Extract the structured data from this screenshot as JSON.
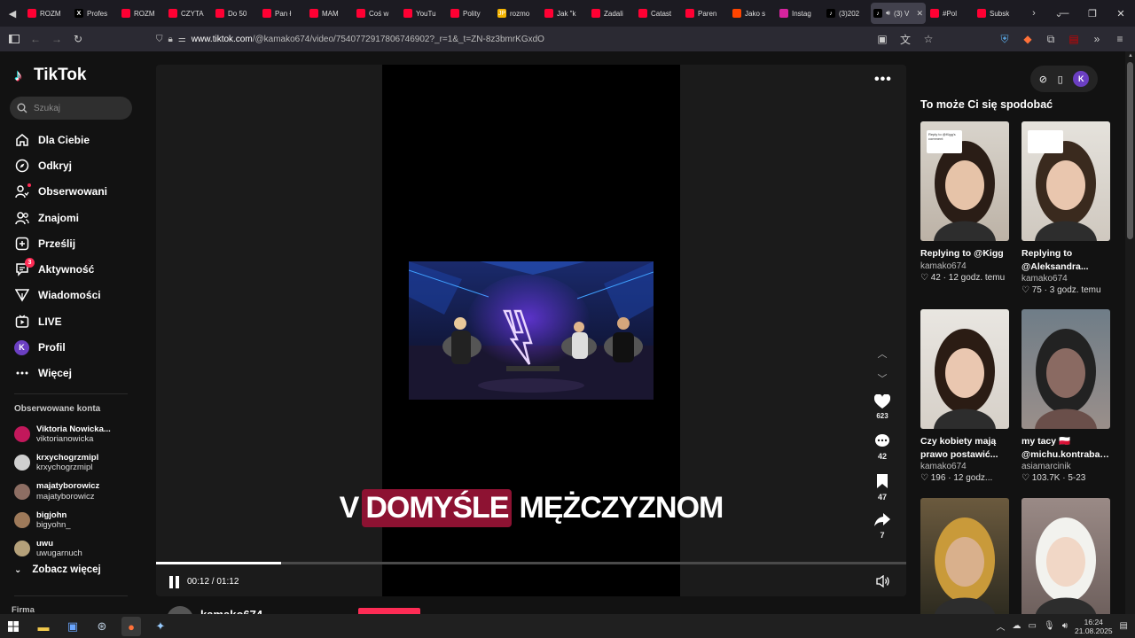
{
  "browser": {
    "tabs": [
      {
        "label": "ROZM",
        "color": "#ff0033",
        "glyph": ""
      },
      {
        "label": "Profes",
        "color": "#000000",
        "glyph": "X"
      },
      {
        "label": "ROZM",
        "color": "#ff0033",
        "glyph": ""
      },
      {
        "label": "CZYTA",
        "color": "#ff0033",
        "glyph": ""
      },
      {
        "label": "Do 50",
        "color": "#ff0033",
        "glyph": ""
      },
      {
        "label": "Pan ł",
        "color": "#ff0033",
        "glyph": ""
      },
      {
        "label": "MAM",
        "color": "#ff0033",
        "glyph": ""
      },
      {
        "label": "Coś w",
        "color": "#ff0033",
        "glyph": ""
      },
      {
        "label": "YouTu",
        "color": "#ff0033",
        "glyph": ""
      },
      {
        "label": "Polity",
        "color": "#ff0033",
        "glyph": ""
      },
      {
        "label": "rozmo",
        "color": "#f4b400",
        "glyph": "JP"
      },
      {
        "label": "Jak \"k",
        "color": "#ff0033",
        "glyph": ""
      },
      {
        "label": "Zadali",
        "color": "#ff0033",
        "glyph": ""
      },
      {
        "label": "Catast",
        "color": "#ff0033",
        "glyph": ""
      },
      {
        "label": "Paren",
        "color": "#ff0033",
        "glyph": ""
      },
      {
        "label": "Jako s",
        "color": "#ff4500",
        "glyph": ""
      },
      {
        "label": "Instag",
        "color": "#d6249f",
        "glyph": ""
      },
      {
        "label": "(3)202",
        "color": "#000000",
        "glyph": "♪"
      },
      {
        "label": "(3) V",
        "color": "#000000",
        "glyph": "♪",
        "active": true
      },
      {
        "label": "#Pol",
        "color": "#ff0033",
        "glyph": ""
      },
      {
        "label": "Subsk",
        "color": "#ff0033",
        "glyph": ""
      }
    ],
    "url_domain": "www.tiktok.com",
    "url_path": "/@kamako674/video/7540772917806746902?_r=1&_t=ZN-8z3bmrKGxdO"
  },
  "sidebar": {
    "logo": "TikTok",
    "search_placeholder": "Szukaj",
    "menu": [
      {
        "label": "Dla Ciebie",
        "icon": "home"
      },
      {
        "label": "Odkryj",
        "icon": "compass"
      },
      {
        "label": "Obserwowani",
        "icon": "following"
      },
      {
        "label": "Znajomi",
        "icon": "friends"
      },
      {
        "label": "Prześlij",
        "icon": "upload"
      },
      {
        "label": "Aktywność",
        "icon": "activity",
        "badge": "3"
      },
      {
        "label": "Wiadomości",
        "icon": "messages"
      },
      {
        "label": "LIVE",
        "icon": "live"
      },
      {
        "label": "Profil",
        "icon": "profile",
        "avatar": "K"
      },
      {
        "label": "Więcej",
        "icon": "more"
      }
    ],
    "followed_title": "Obserwowane konta",
    "followed": [
      {
        "name": "Viktoria Nowicka...",
        "handle": "viktorianowicka",
        "color": "#c2185b"
      },
      {
        "name": "krxychogrzmipl",
        "handle": "krxychogrzmipl",
        "color": "#cfcfcf"
      },
      {
        "name": "majatyborowicz",
        "handle": "majatyborowicz",
        "color": "#8d6e63"
      },
      {
        "name": "bigjohn",
        "handle": "bigyohn_",
        "color": "#9e7a5a"
      },
      {
        "name": "uwu",
        "handle": "uwugarnuch",
        "color": "#b5a17a"
      }
    ],
    "see_more": "Zobacz więcej",
    "firm": "Firma"
  },
  "video": {
    "caption_lead": "V",
    "caption_highlight": "DOMYŚLE",
    "caption_rest": "MĘŻCZYZNOM",
    "progress": 0.1667,
    "time": "00:12 / 01:12",
    "actions": {
      "likes": "623",
      "comments": "42",
      "saves": "47",
      "shares": "7"
    },
    "author": "kamako674"
  },
  "recommendations": {
    "title": "To może Ci się spodobać",
    "avatar": "K",
    "items": [
      {
        "title": "Replying to @Kigg",
        "user": "kamako674",
        "likes": "42",
        "time": "12 godz. temu",
        "sticker": "Reply to @Kigg's comment"
      },
      {
        "title": "Replying to @Aleksandra...",
        "user": "kamako674",
        "likes": "75",
        "time": "3 godz. temu",
        "sticker": ""
      },
      {
        "title": "Czy kobiety mają prawo postawić...",
        "user": "kamako674",
        "likes": "196",
        "time": "12 godz...",
        "sticker": ""
      },
      {
        "title": "my tacy 🇵🇱 @michu.kontrabas...",
        "user": "asiamarcinik",
        "likes": "103.7K",
        "time": "5-23",
        "sticker": ""
      },
      {
        "title": "",
        "user": "",
        "likes": "",
        "time": "",
        "sticker": ""
      },
      {
        "title": "",
        "user": "",
        "likes": "",
        "time": "",
        "sticker": ""
      }
    ]
  },
  "taskbar": {
    "time": "16:24",
    "date": "21.08.2025"
  }
}
